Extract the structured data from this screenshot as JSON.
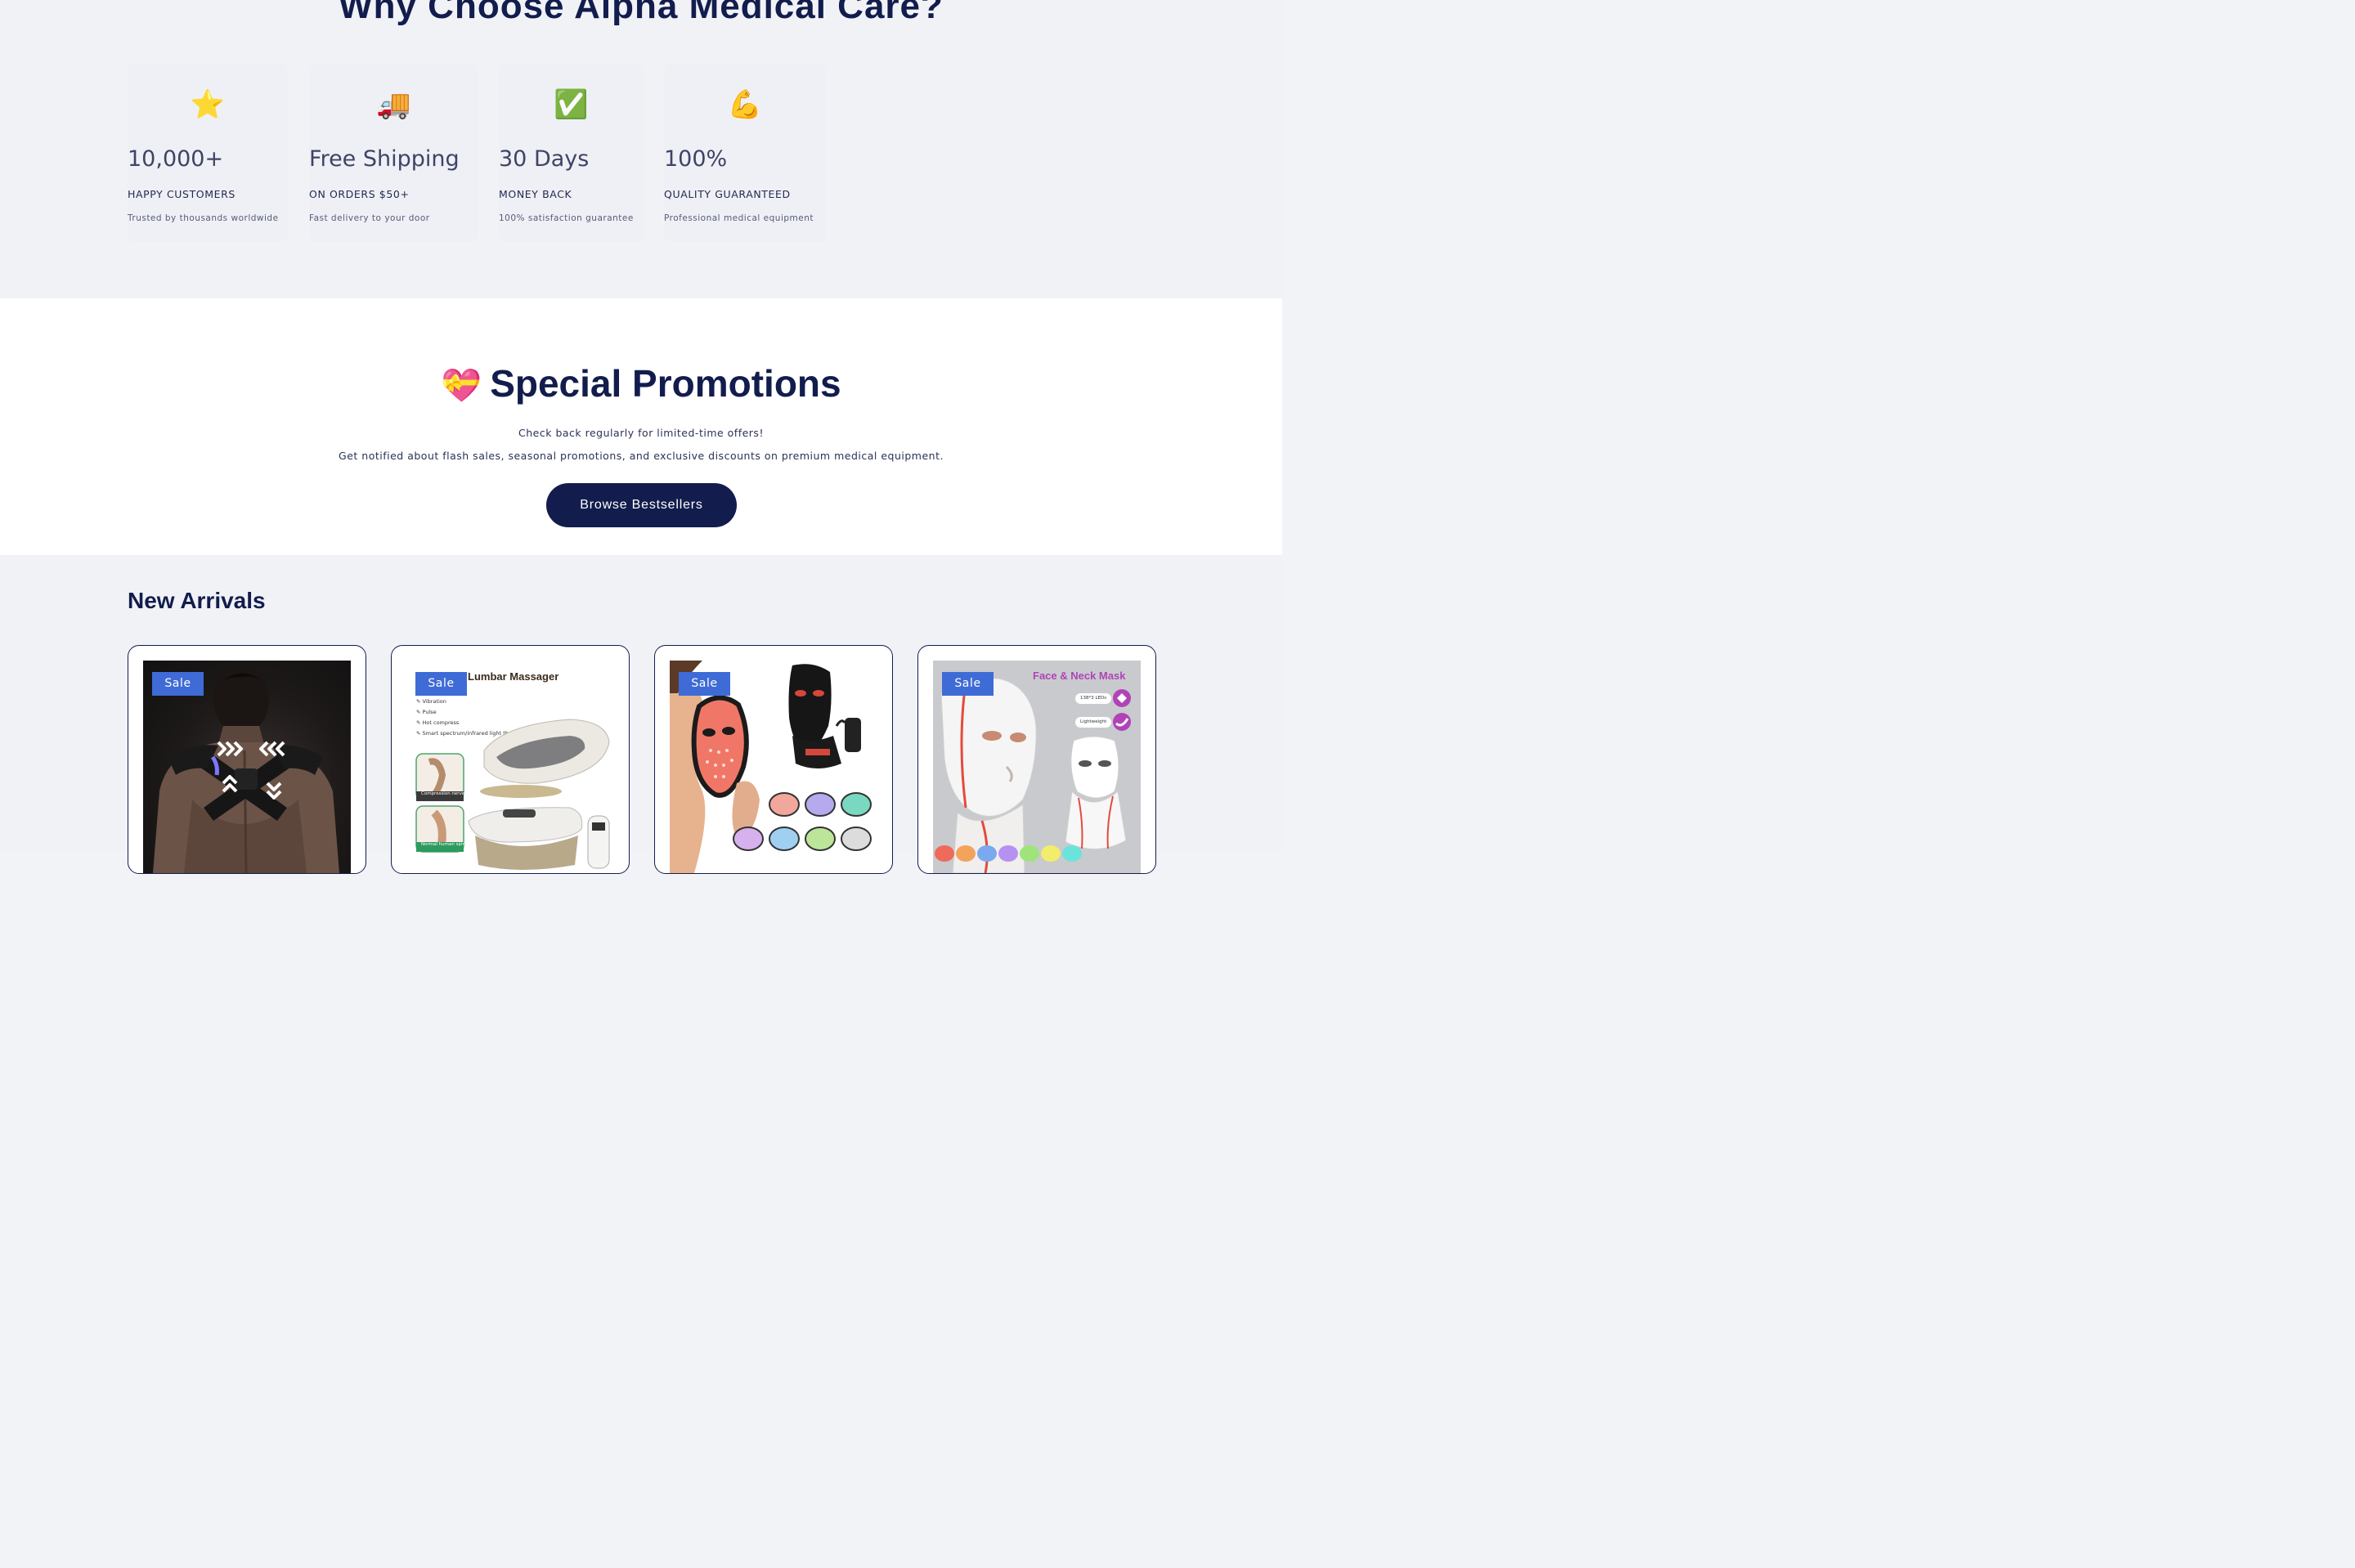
{
  "why": {
    "title": "Why Choose Alpha Medical Care?",
    "stats": [
      {
        "icon": "star-icon",
        "glyph": "⭐",
        "value": "10,000+",
        "label": "HAPPY CUSTOMERS",
        "desc": "Trusted by thousands worldwide"
      },
      {
        "icon": "delivery-truck-icon",
        "glyph": "🚚",
        "value": "Free Shipping",
        "label": "ON ORDERS $50+",
        "desc": "Fast delivery to your door"
      },
      {
        "icon": "check-mark-icon",
        "glyph": "✅",
        "value": "30 Days",
        "label": "MONEY BACK",
        "desc": "100% satisfaction guarantee"
      },
      {
        "icon": "flexed-biceps-icon",
        "glyph": "💪",
        "value": "100%",
        "label": "QUALITY GUARANTEED",
        "desc": "Professional medical equipment"
      }
    ]
  },
  "promo": {
    "heart_glyph": "💝",
    "title": "Special Promotions",
    "line1": "Check back regularly for limited-time offers!",
    "line2": "Get notified about flash sales, seasonal promotions, and exclusive discounts on premium medical equipment.",
    "button": "Browse Bestsellers"
  },
  "arrivals": {
    "title": "New Arrivals",
    "products": [
      {
        "badge": "Sale",
        "image": "posture-corrector-image"
      },
      {
        "badge": "Sale",
        "image": "lumbar-massager-image",
        "img_title": "Lumbar Massager",
        "features": [
          "Vibration",
          "Pulse",
          "Hot compress",
          "Smart spectrum/infrared light therapy"
        ],
        "caption1": "Compression nerve",
        "caption2": "Normal human spine"
      },
      {
        "badge": "Sale",
        "image": "led-face-mask-image"
      },
      {
        "badge": "Sale",
        "image": "face-neck-mask-image",
        "img_title": "Face & Neck Mask",
        "tag1": "138*3 LEDs",
        "tag2": "Lightweight"
      }
    ]
  },
  "colors": {
    "navy": "#121d4d",
    "sale_blue": "#3e6bd6",
    "section_gray": "#f1f2f6",
    "white": "#ffffff"
  }
}
